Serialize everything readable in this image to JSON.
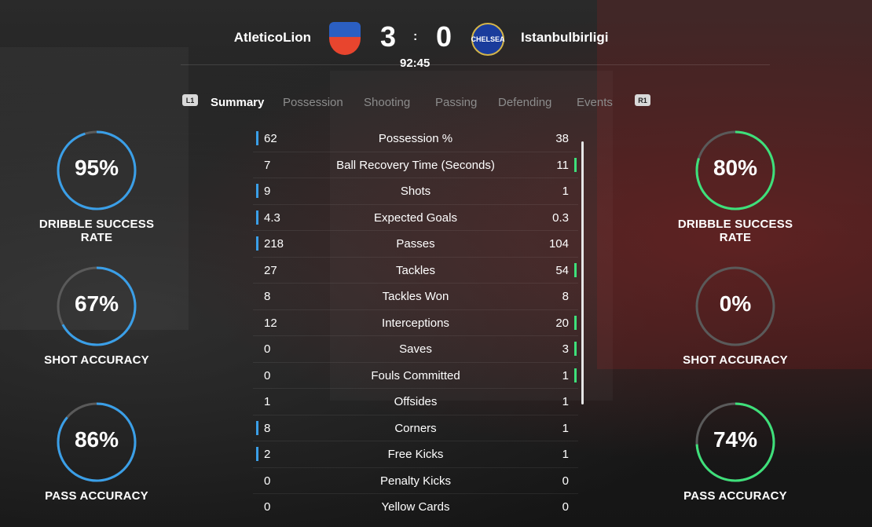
{
  "match": {
    "home_team": "AtleticoLion",
    "away_team": "Istanbulbirligi",
    "home_score": "3",
    "away_score": "0",
    "score_separator": ":",
    "clock": "92:45",
    "away_crest_text": "CHELSEA"
  },
  "tabs": {
    "prev_hint": "L1",
    "next_hint": "R1",
    "items": [
      "Summary",
      "Possession",
      "Shooting",
      "Passing",
      "Defending",
      "Events"
    ],
    "active": "Summary"
  },
  "colors": {
    "home_accent": "#3a9fe8",
    "away_accent": "#3ee07a",
    "neutral_ring": "#5a5a5a"
  },
  "home_gauges": [
    {
      "value": "95%",
      "fraction": 0.95,
      "label": "DRIBBLE SUCCESS RATE"
    },
    {
      "value": "67%",
      "fraction": 0.67,
      "label": "SHOT ACCURACY"
    },
    {
      "value": "86%",
      "fraction": 0.86,
      "label": "PASS ACCURACY"
    }
  ],
  "away_gauges": [
    {
      "value": "80%",
      "fraction": 0.8,
      "label": "DRIBBLE SUCCESS RATE"
    },
    {
      "value": "0%",
      "fraction": 0.0,
      "label": "SHOT ACCURACY"
    },
    {
      "value": "74%",
      "fraction": 0.74,
      "label": "PASS ACCURACY"
    }
  ],
  "stats": [
    {
      "name": "Possession %",
      "home": "62",
      "away": "38",
      "leader": "home"
    },
    {
      "name": "Ball Recovery Time (Seconds)",
      "home": "7",
      "away": "11",
      "leader": "away"
    },
    {
      "name": "Shots",
      "home": "9",
      "away": "1",
      "leader": "home"
    },
    {
      "name": "Expected Goals",
      "home": "4.3",
      "away": "0.3",
      "leader": "home"
    },
    {
      "name": "Passes",
      "home": "218",
      "away": "104",
      "leader": "home"
    },
    {
      "name": "Tackles",
      "home": "27",
      "away": "54",
      "leader": "away"
    },
    {
      "name": "Tackles Won",
      "home": "8",
      "away": "8",
      "leader": "none"
    },
    {
      "name": "Interceptions",
      "home": "12",
      "away": "20",
      "leader": "away"
    },
    {
      "name": "Saves",
      "home": "0",
      "away": "3",
      "leader": "away"
    },
    {
      "name": "Fouls Committed",
      "home": "0",
      "away": "1",
      "leader": "away"
    },
    {
      "name": "Offsides",
      "home": "1",
      "away": "1",
      "leader": "none"
    },
    {
      "name": "Corners",
      "home": "8",
      "away": "1",
      "leader": "home"
    },
    {
      "name": "Free Kicks",
      "home": "2",
      "away": "1",
      "leader": "home"
    },
    {
      "name": "Penalty Kicks",
      "home": "0",
      "away": "0",
      "leader": "none"
    },
    {
      "name": "Yellow Cards",
      "home": "0",
      "away": "0",
      "leader": "none"
    }
  ]
}
